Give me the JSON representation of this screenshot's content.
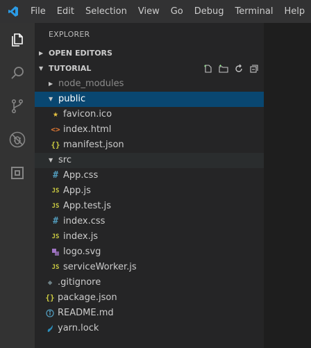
{
  "menu": {
    "items": [
      "File",
      "Edit",
      "Selection",
      "View",
      "Go",
      "Debug",
      "Terminal",
      "Help"
    ]
  },
  "activity_bar": {
    "icons": [
      "explorer-icon",
      "search-icon",
      "source-control-icon",
      "debug-icon",
      "extensions-icon"
    ],
    "active": "explorer-icon"
  },
  "sidebar": {
    "title": "EXPLORER",
    "open_editors": "OPEN EDITORS",
    "workspace": "TUTORIAL",
    "actions": [
      "new-file-icon",
      "new-folder-icon",
      "refresh-icon",
      "collapse-all-icon"
    ]
  },
  "tree": {
    "node_modules": "node_modules",
    "public": "public",
    "public_files": [
      "favicon.ico",
      "index.html",
      "manifest.json"
    ],
    "src": "src",
    "src_files": [
      "App.css",
      "App.js",
      "App.test.js",
      "index.css",
      "index.js",
      "logo.svg",
      "serviceWorker.js"
    ],
    "root_files": [
      ".gitignore",
      "package.json",
      "README.md",
      "yarn.lock"
    ]
  },
  "colors": {
    "selection": "#094771",
    "accent": "#007acc",
    "js": "#cbcb41",
    "css": "#519aba",
    "html": "#e37933",
    "svg": "#a074c4"
  }
}
